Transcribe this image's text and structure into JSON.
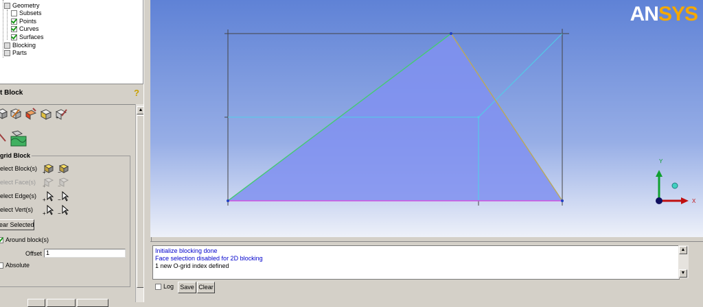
{
  "tree": {
    "items": [
      {
        "label": "Geometry",
        "state": "grey"
      },
      {
        "label": "Subsets",
        "state": "unchecked"
      },
      {
        "label": "Points",
        "state": "checked"
      },
      {
        "label": "Curves",
        "state": "checked"
      },
      {
        "label": "Surfaces",
        "state": "checked"
      },
      {
        "label": "Blocking",
        "state": "grey"
      },
      {
        "label": "Parts",
        "state": "grey"
      }
    ]
  },
  "panel": {
    "title": "t Block",
    "group_label": "grid Block",
    "select_blocks": "elect Block(s)",
    "select_faces": "elect Face(s)",
    "select_edges": "elect Edge(s)",
    "select_verts": "elect Vert(s)",
    "clear_selected": "ear Selected",
    "around_blocks": "Around block(s)",
    "offset_label": "Offset",
    "offset_value": "1",
    "absolute": "Absolute"
  },
  "viewport": {
    "logo_main": "AN",
    "logo_accent": "SYS",
    "axis_y": "Y",
    "axis_x": "X"
  },
  "messages": {
    "lines": [
      {
        "text": "Initialize blocking done",
        "color": "#0000cc"
      },
      {
        "text": "Face selection disabled for 2D blocking",
        "color": "#0000cc"
      },
      {
        "text": "1 new O-grid index defined",
        "color": "#000000"
      }
    ],
    "log_label": "Log",
    "save_label": "Save",
    "clear_label": "Clear"
  },
  "colors": {
    "viewport_top": "#5f82d6",
    "triangle_fill": "#8090f0",
    "ogrid_line": "#4fd0e8",
    "edge_green": "#48c878",
    "edge_magenta": "#d050e0"
  }
}
